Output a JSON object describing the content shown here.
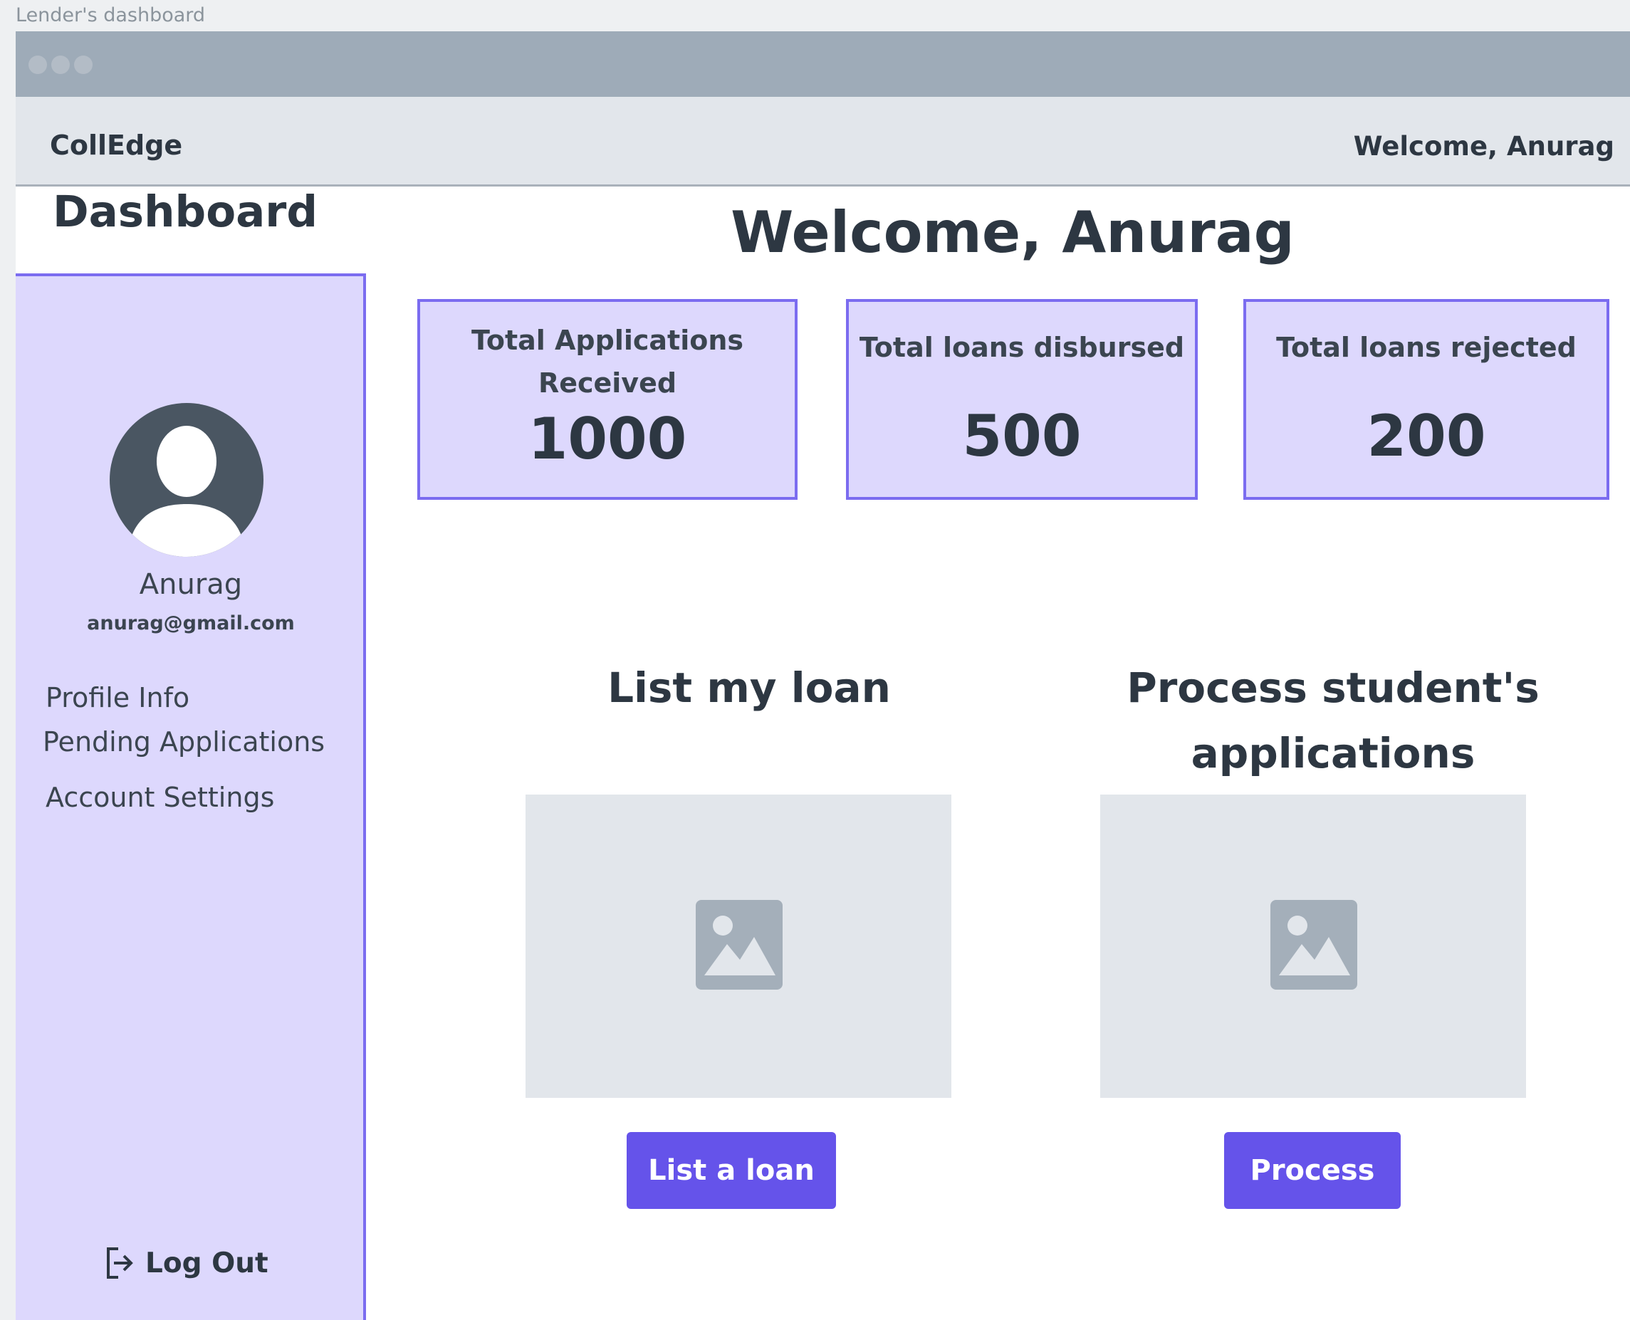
{
  "caption": "Lender's dashboard",
  "navbar": {
    "brand": "CollEdge",
    "welcome": "Welcome, Anurag"
  },
  "sidebar": {
    "title": "Dashboard",
    "user_name": "Anurag",
    "user_email": "anurag@gmail.com",
    "nav_items": [
      {
        "label": "Profile Info"
      },
      {
        "label": "Pending Applications"
      },
      {
        "label": "Account Settings"
      }
    ],
    "logout_label": "Log Out"
  },
  "main": {
    "welcome": "Welcome, Anurag",
    "stats": [
      {
        "label_line1": "Total Applications",
        "label_line2": "Received",
        "value": "1000"
      },
      {
        "label_line1": "Total loans disbursed",
        "value": "500"
      },
      {
        "label_line1": "Total loans rejected",
        "value": "200"
      }
    ],
    "sections": [
      {
        "title_line1": "List my loan",
        "button": "List a loan"
      },
      {
        "title_line1": "Process student's",
        "title_line2": "applications",
        "button": "Process"
      }
    ]
  },
  "colors": {
    "accent": "#6553ea",
    "card_bg": "#ddd8fd",
    "card_border": "#7b6cf0",
    "titlebar": "#9eabb8",
    "placeholder": "#e2e6eb"
  },
  "icons": [
    "user-avatar-icon",
    "logout-icon",
    "image-placeholder-icon"
  ]
}
